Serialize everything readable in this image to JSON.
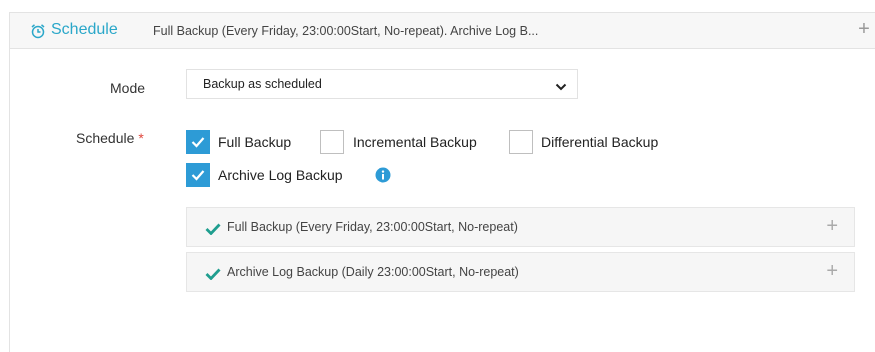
{
  "header": {
    "title": "Schedule",
    "summary": "Full Backup (Every Friday, 23:00:00Start, No-repeat). Archive Log B...",
    "icon": "alarm-clock-icon",
    "expand_icon": "plus-icon"
  },
  "form": {
    "mode_label": "Mode",
    "mode_value": "Backup as scheduled",
    "schedule_label": "Schedule",
    "required_mark": "*"
  },
  "checkboxes": [
    {
      "label": "Full Backup",
      "checked": true
    },
    {
      "label": "Incremental Backup",
      "checked": false
    },
    {
      "label": "Differential Backup",
      "checked": false
    },
    {
      "label": "Archive Log Backup",
      "checked": true
    }
  ],
  "schedules": [
    {
      "text": "Full Backup (Every Friday, 23:00:00Start, No-repeat)"
    },
    {
      "text": "Archive Log Backup (Daily 23:00:00Start, No-repeat)"
    }
  ],
  "colors": {
    "accent": "#2aa7c9",
    "checkbox_checked": "#2d9bd6",
    "check_green": "#1f9e8f",
    "required": "#e0463c"
  }
}
